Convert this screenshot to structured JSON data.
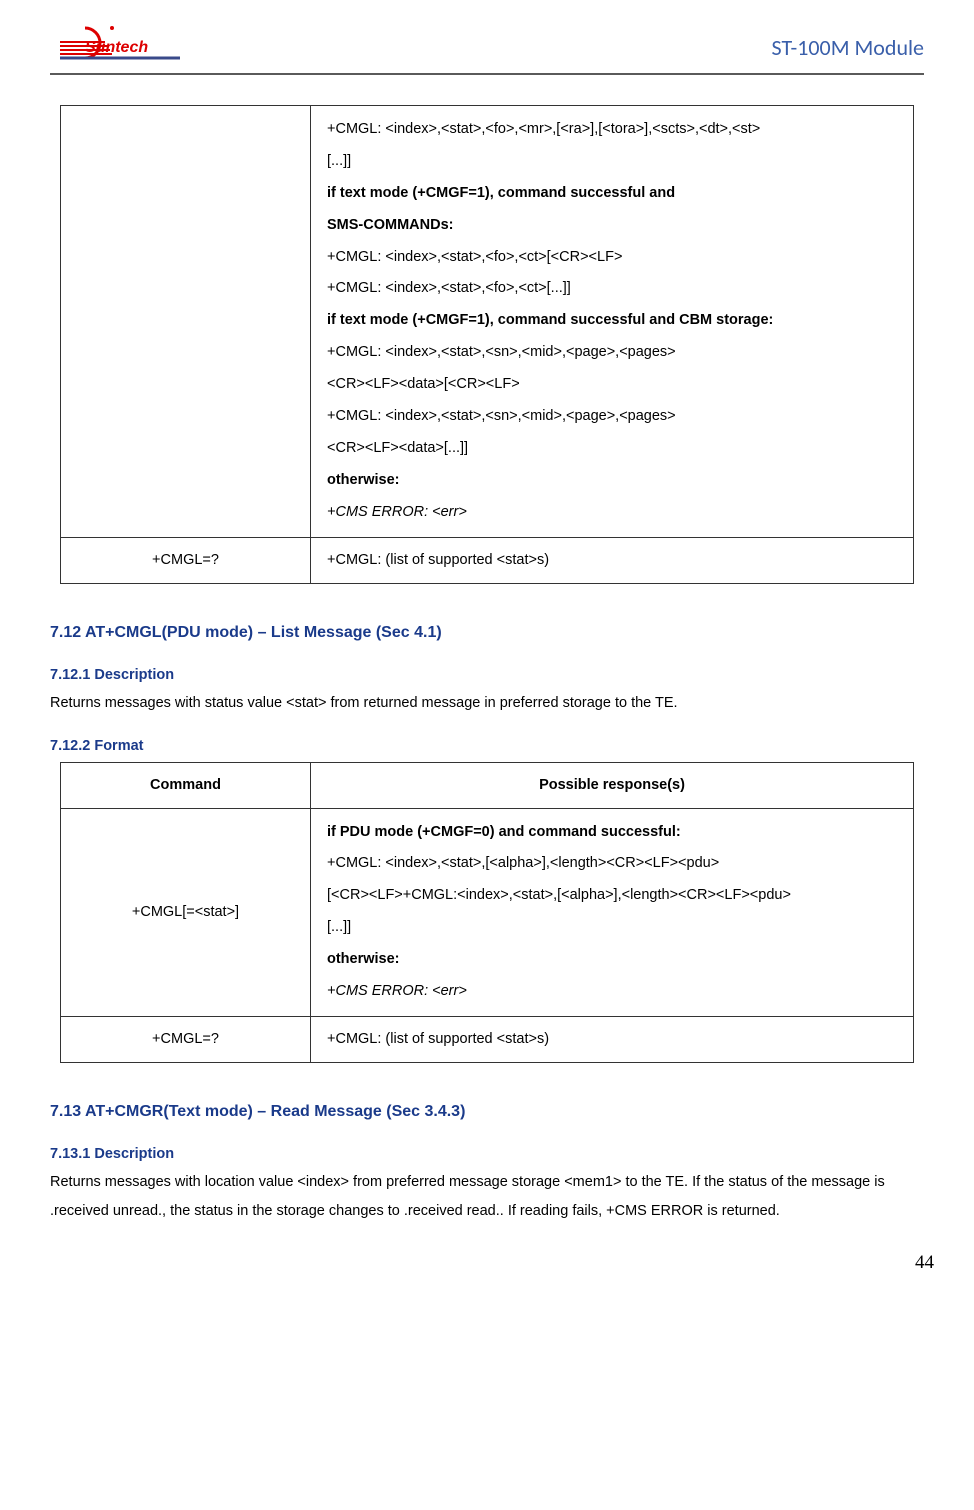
{
  "header": {
    "logo_text": "Suntech",
    "title": "ST-100M Module"
  },
  "table1": {
    "row1": {
      "response": {
        "line1": "+CMGL: <index>,<stat>,<fo>,<mr>,[<ra>],[<tora>],<scts>,<dt>,<st>",
        "line2": "[...]]",
        "line3": "if text mode (+CMGF=1), command successful and",
        "line4": "SMS-COMMANDs:",
        "line5": "+CMGL: <index>,<stat>,<fo>,<ct>[<CR><LF>",
        "line6": "+CMGL: <index>,<stat>,<fo>,<ct>[...]]",
        "line7": "if text mode (+CMGF=1), command successful and CBM storage:",
        "line8": "+CMGL: <index>,<stat>,<sn>,<mid>,<page>,<pages>",
        "line9": "<CR><LF><data>[<CR><LF>",
        "line10": "+CMGL: <index>,<stat>,<sn>,<mid>,<page>,<pages>",
        "line11": "<CR><LF><data>[...]]",
        "line12": "otherwise:",
        "line13": "+CMS ERROR: <err>"
      }
    },
    "row2": {
      "command": "+CMGL=?",
      "response": "+CMGL: (list of supported <stat>s)"
    }
  },
  "section712": {
    "heading": "7.12 AT+CMGL(PDU mode) – List Message (Sec 4.1)",
    "desc_heading": "7.12.1 Description",
    "desc_text": "Returns messages with status value <stat> from returned message in preferred storage to the TE.",
    "format_heading": "7.12.2 Format"
  },
  "table2": {
    "header": {
      "col1": "Command",
      "col2": "Possible response(s)"
    },
    "row1": {
      "command": "+CMGL[=<stat>]",
      "response": {
        "line1": "if PDU mode (+CMGF=0) and command successful:",
        "line2": "+CMGL: <index>,<stat>,[<alpha>],<length><CR><LF><pdu>",
        "line3": "[<CR><LF>+CMGL:<index>,<stat>,[<alpha>],<length><CR><LF><pdu>",
        "line4": "[...]]",
        "line5": "otherwise:",
        "line6": "+CMS ERROR: <err>"
      }
    },
    "row2": {
      "command": "+CMGL=?",
      "response": "+CMGL: (list of supported <stat>s)"
    }
  },
  "section713": {
    "heading": "7.13 AT+CMGR(Text mode) – Read Message (Sec 3.4.3)",
    "desc_heading": "7.13.1 Description",
    "desc_text": "Returns messages with location value <index> from preferred message storage <mem1> to the TE. If the status of the message is .received unread., the status in the storage changes to .received read.. If reading fails, +CMS ERROR is returned."
  },
  "page_number": "44"
}
